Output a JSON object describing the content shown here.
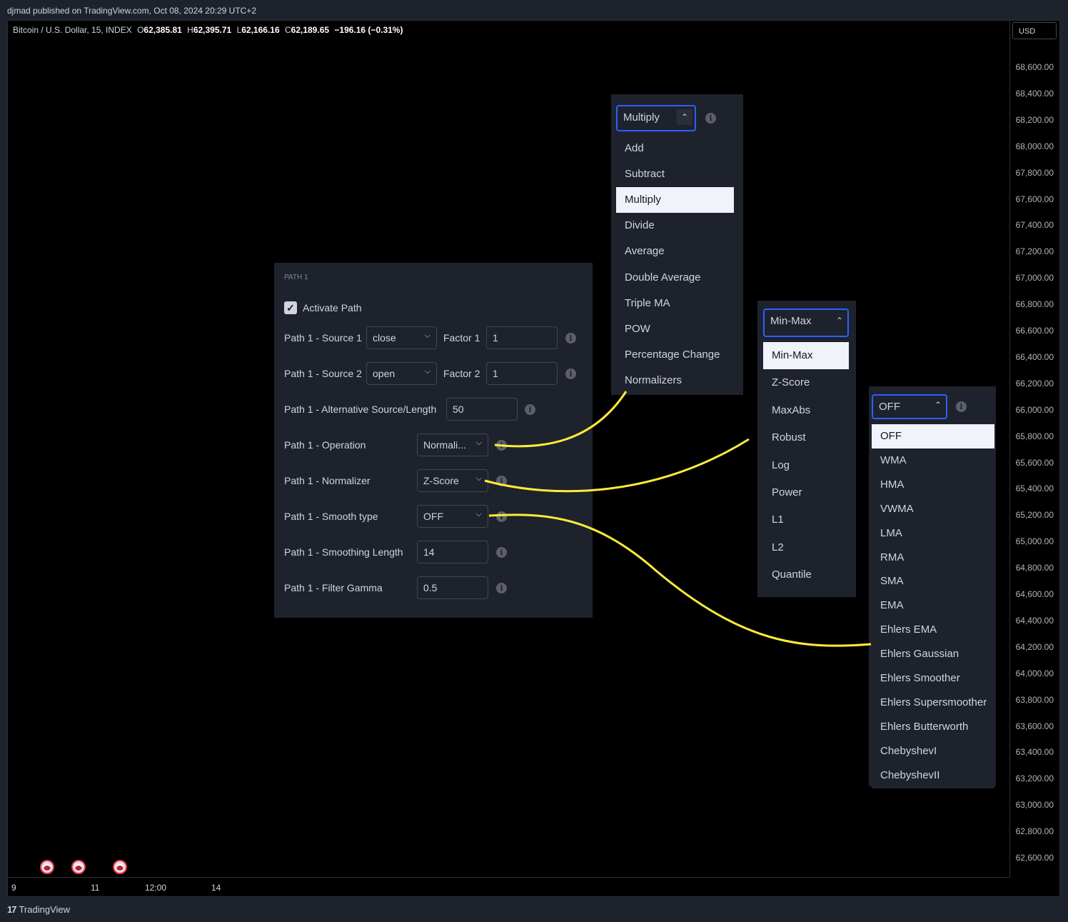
{
  "header": {
    "published": "djmad published on TradingView.com, Oct 08, 2024 20:29 UTC+2"
  },
  "legend": {
    "symbol": "Bitcoin / U.S. Dollar, 15, INDEX",
    "o_label": "O",
    "o": "62,385.81",
    "h_label": "H",
    "h": "62,395.71",
    "l_label": "L",
    "l": "62,166.16",
    "c_label": "C",
    "c": "62,189.65",
    "change": "−196.16 (−0.31%)"
  },
  "currency": "USD",
  "price_axis": [
    "68,600.00",
    "68,400.00",
    "68,200.00",
    "68,000.00",
    "67,800.00",
    "67,600.00",
    "67,400.00",
    "67,200.00",
    "67,000.00",
    "66,800.00",
    "66,600.00",
    "66,400.00",
    "66,200.00",
    "66,000.00",
    "65,800.00",
    "65,600.00",
    "65,400.00",
    "65,200.00",
    "65,000.00",
    "64,800.00",
    "64,600.00",
    "64,400.00",
    "64,200.00",
    "64,000.00",
    "63,800.00",
    "63,600.00",
    "63,400.00",
    "63,200.00",
    "63,000.00",
    "62,800.00",
    "62,600.00"
  ],
  "time_axis": [
    "9",
    "11",
    "12:00",
    "14"
  ],
  "footer": {
    "logo": "17",
    "brand": "TradingView"
  },
  "settings": {
    "section": "PATH 1",
    "activate_label": "Activate Path",
    "source1_label": "Path 1 - Source 1",
    "source1_value": "close",
    "factor1_label": "Factor 1",
    "factor1_value": "1",
    "source2_label": "Path 1 - Source 2",
    "source2_value": "open",
    "factor2_label": "Factor 2",
    "factor2_value": "1",
    "alt_label": "Path 1 - Alternative Source/Length",
    "alt_value": "50",
    "operation_label": "Path 1 - Operation",
    "operation_value": "Normali...",
    "normalizer_label": "Path 1 - Normalizer",
    "normalizer_value": "Z-Score",
    "smooth_label": "Path 1 - Smooth type",
    "smooth_value": "OFF",
    "smooth_len_label": "Path 1 - Smoothing Length",
    "smooth_len_value": "14",
    "gamma_label": "Path 1 - Filter Gamma",
    "gamma_value": "0.5"
  },
  "operation_dropdown": {
    "selected": "Multiply",
    "items": [
      "Add",
      "Subtract",
      "Multiply",
      "Divide",
      "Average",
      "Double Average",
      "Triple MA",
      "POW",
      "Percentage Change",
      "Normalizers"
    ]
  },
  "normalizer_dropdown": {
    "selected": "Min-Max",
    "items": [
      "Min-Max",
      "Z-Score",
      "MaxAbs",
      "Robust",
      "Log",
      "Power",
      "L1",
      "L2",
      "Quantile"
    ]
  },
  "smooth_dropdown": {
    "selected": "OFF",
    "items": [
      "OFF",
      "WMA",
      "HMA",
      "VWMA",
      "LMA",
      "RMA",
      "SMA",
      "EMA",
      "Ehlers EMA",
      "Ehlers Gaussian",
      "Ehlers Smoother",
      "Ehlers Supersmoother",
      "Ehlers Butterworth",
      "ChebyshevI",
      "ChebyshevII"
    ]
  },
  "colors": {
    "accent": "#2962ff",
    "annotation": "#ffeb3b",
    "chart_bg": "#000000",
    "panel_bg": "#1e222d"
  },
  "icons": {
    "info": "info-icon",
    "check": "checkmark-icon",
    "chevron_down": "chevron-down-icon",
    "chevron_up": "chevron-up-icon"
  }
}
